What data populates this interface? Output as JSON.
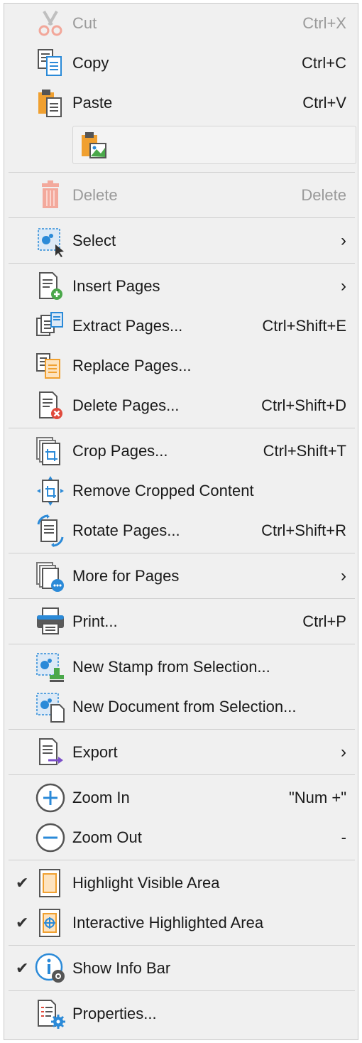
{
  "menu": {
    "cut": {
      "label": "Cut",
      "shortcut": "Ctrl+X",
      "icon": "scissors-icon"
    },
    "copy": {
      "label": "Copy",
      "shortcut": "Ctrl+C",
      "icon": "copy-icon"
    },
    "paste": {
      "label": "Paste",
      "shortcut": "Ctrl+V",
      "icon": "paste-icon"
    },
    "paste_special": {
      "icon": "paste-image-icon"
    },
    "delete": {
      "label": "Delete",
      "shortcut": "Delete",
      "icon": "trash-icon"
    },
    "select": {
      "label": "Select",
      "arrow": "›",
      "icon": "select-area-icon"
    },
    "insert_pages": {
      "label": "Insert Pages",
      "arrow": "›",
      "icon": "insert-pages-icon"
    },
    "extract_pages": {
      "label": "Extract Pages...",
      "shortcut": "Ctrl+Shift+E",
      "icon": "extract-pages-icon"
    },
    "replace_pages": {
      "label": "Replace Pages...",
      "icon": "replace-pages-icon"
    },
    "delete_pages": {
      "label": "Delete Pages...",
      "shortcut": "Ctrl+Shift+D",
      "icon": "delete-pages-icon"
    },
    "crop_pages": {
      "label": "Crop Pages...",
      "shortcut": "Ctrl+Shift+T",
      "icon": "crop-pages-icon"
    },
    "remove_cropped": {
      "label": "Remove Cropped Content",
      "icon": "remove-cropped-icon"
    },
    "rotate_pages": {
      "label": "Rotate Pages...",
      "shortcut": "Ctrl+Shift+R",
      "icon": "rotate-pages-icon"
    },
    "more_for_pages": {
      "label": "More for Pages",
      "arrow": "›",
      "icon": "more-pages-icon"
    },
    "print": {
      "label": "Print...",
      "shortcut": "Ctrl+P",
      "icon": "printer-icon"
    },
    "new_stamp": {
      "label": "New Stamp from Selection...",
      "icon": "new-stamp-icon"
    },
    "new_document": {
      "label": "New Document from Selection...",
      "icon": "new-document-icon"
    },
    "export": {
      "label": "Export",
      "arrow": "›",
      "icon": "export-icon"
    },
    "zoom_in": {
      "label": "Zoom In",
      "shortcut": "\"Num +\"",
      "icon": "zoom-in-icon"
    },
    "zoom_out": {
      "label": "Zoom Out",
      "shortcut": "-",
      "icon": "zoom-out-icon"
    },
    "highlight_visible": {
      "label": "Highlight Visible Area",
      "check": "✔",
      "checked": true,
      "icon": "highlight-area-icon"
    },
    "interactive_highlighted": {
      "label": "Interactive Highlighted Area",
      "check": "✔",
      "checked": true,
      "icon": "interactive-area-icon"
    },
    "show_info_bar": {
      "label": "Show Info Bar",
      "check": "✔",
      "checked": true,
      "icon": "info-icon"
    },
    "properties": {
      "label": "Properties...",
      "icon": "properties-icon"
    }
  },
  "colors": {
    "menu_bg": "#f0f0f0",
    "separator": "#cfcfcf",
    "disabled_text": "#9a9a9a",
    "accent_blue": "#2b8ad8",
    "accent_orange": "#f0a030",
    "accent_red": "#e04a3c"
  }
}
